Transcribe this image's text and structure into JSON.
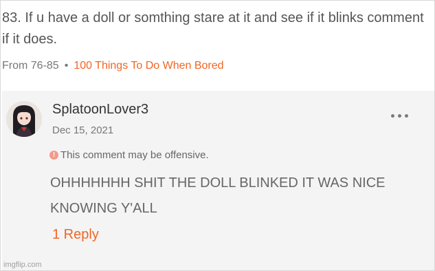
{
  "post": {
    "body": "83. If u have a doll or somthing stare at it and see if it blinks comment if it does.",
    "range": "From 76-85",
    "separator": "•",
    "list_link": "100 Things To Do When Bored"
  },
  "comment": {
    "username": "SplatoonLover3",
    "date": "Dec 15, 2021",
    "warning": "This comment may be offensive.",
    "text": "OHHHHHHH SHIT THE DOLL BLINKED IT WAS NICE KNOWING Y'ALL",
    "reply_label": "1 Reply",
    "more_icon": "more-horizontal-icon",
    "warning_icon": "alert-circle-icon"
  },
  "watermark": "imgflip.com",
  "colors": {
    "accent": "#f26522",
    "text": "#555555",
    "muted": "#777777",
    "comment_bg": "#f4f4f4",
    "warning_icon": "#f39a8a"
  }
}
